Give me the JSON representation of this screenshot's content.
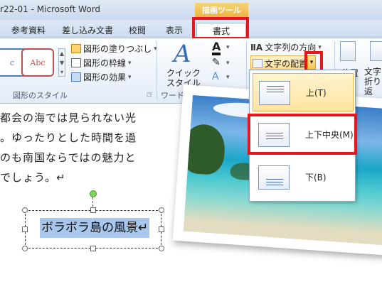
{
  "window": {
    "title": "r22-01 - Microsoft Word",
    "context_tab": "描画ツール"
  },
  "tabs": [
    {
      "label": "参考資料"
    },
    {
      "label": "差し込み文書"
    },
    {
      "label": "校閲"
    },
    {
      "label": "表示"
    },
    {
      "label": "書式"
    }
  ],
  "ribbon": {
    "shape_styles": {
      "style1": "c",
      "style2": "Abc",
      "fill": "図形の塗りつぶし",
      "outline": "図形の枠線",
      "effects": "図形の効果",
      "group_label": "図形のスタイル"
    },
    "wordart": {
      "quick_style_line1": "クイック",
      "quick_style_line2": "スタイル",
      "text_a": "A",
      "group_label": "ワードアートのスタイル"
    },
    "text": {
      "direction": "文字列の方向",
      "align": "文字の配置"
    },
    "arrange": {
      "position": "位置",
      "wrap_line1": "文字",
      "wrap_line2": "折り返"
    }
  },
  "document": {
    "lines": [
      "都会の海では見られない光",
      "。ゆったりとした時間を過",
      "のも南国ならではの魅力と",
      "でしょう。↵"
    ],
    "textbox_text": "ボラボラ島の風景↵"
  },
  "dropdown": {
    "items": [
      {
        "label": "上(T)"
      },
      {
        "label": "上下中央(M)"
      },
      {
        "label": "下(B)"
      }
    ]
  },
  "colors": {
    "highlight": "#e8141e",
    "context_tab": "#e9b53a",
    "selection": "#a9c6ec"
  }
}
